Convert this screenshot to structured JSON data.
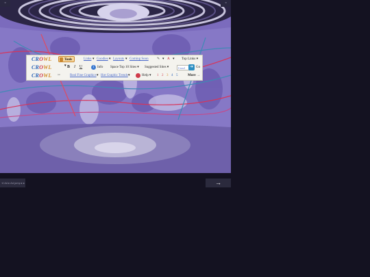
{
  "window": {
    "corner_left_label": "◦",
    "corner_right_label": "◦"
  },
  "toolbar": {
    "rows": [
      {
        "logo": {
          "c": "CR",
          "o": "O",
          "w": "WL"
        },
        "tools_label": "Tools ▾",
        "links": [
          {
            "label": "Links",
            "arrow": "▾"
          },
          {
            "label": "Goodies",
            "arrow": "▾"
          },
          {
            "label": "Layouts",
            "arrow": "▾"
          },
          {
            "label": "Coming Soon"
          }
        ],
        "pen_arrow": "▾",
        "text_color_arrow": "▾",
        "top_links_label": "Top Links ▾"
      },
      {
        "logo": {
          "c": "CR",
          "o": "O",
          "w": "WL"
        },
        "bold": "B",
        "italic": "I",
        "underline": "U",
        "info_icon": "i",
        "info_label": "Info",
        "space_top10_label": "Space Top 10 Sites ▾",
        "suggested_label": "Suggested Sites ▾",
        "search_value": "Crowl",
        "go_label": "Go"
      },
      {
        "logo": {
          "c": "CR",
          "o": "O",
          "w": "WL"
        },
        "bottom_links": [
          {
            "label": "Real Fine Graphics",
            "arrow": "▾"
          },
          {
            "label": "Hot Graphic Trends",
            "arrow": "▾"
          }
        ],
        "help_label": "Help ▾",
        "pages": [
          "1",
          "2",
          "3",
          "4",
          "5"
        ],
        "more_label": "More →"
      }
    ]
  },
  "footer": {
    "page_nav_label": "⊲ Ad ▸ Ad jump ▸ ▸",
    "next_label": "→"
  },
  "colors": {
    "accent_blue": "#2a64b8",
    "accent_red": "#cf3a4a",
    "accent_orange": "#d28c2a",
    "background": "#141221"
  }
}
